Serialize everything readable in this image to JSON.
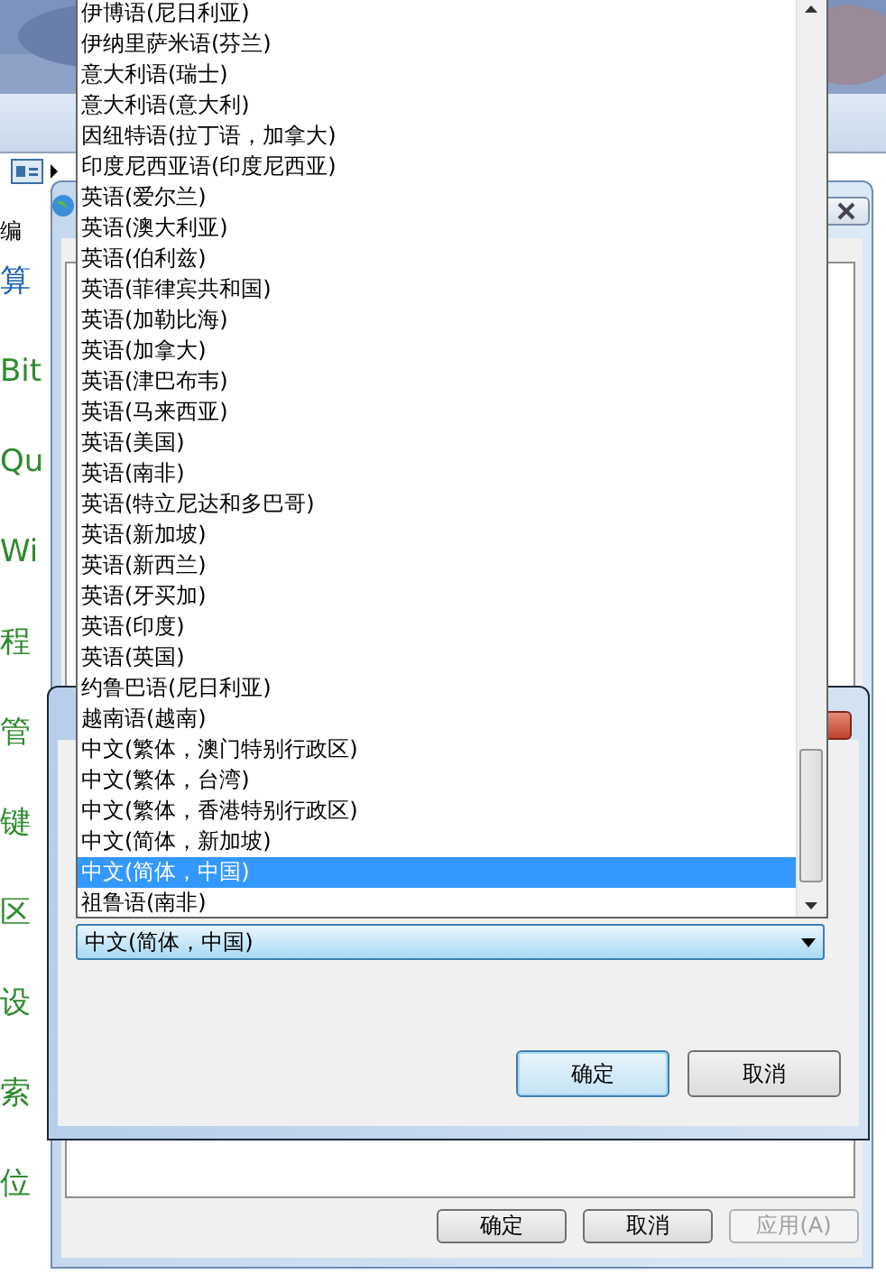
{
  "background": {
    "side_texts": [
      {
        "text": "编",
        "color": "#000000"
      },
      {
        "text": "算",
        "color": "#1a5fb4"
      },
      {
        "text": "Bit",
        "color": "#2e8b2e"
      },
      {
        "text": "Qu",
        "color": "#2e8b2e"
      },
      {
        "text": "Wi",
        "color": "#2e8b2e"
      },
      {
        "text": "程",
        "color": "#2e8b2e"
      },
      {
        "text": "管",
        "color": "#2e8b2e"
      },
      {
        "text": "键",
        "color": "#2e8b2e"
      },
      {
        "text": "区",
        "color": "#2e8b2e"
      },
      {
        "text": "设",
        "color": "#2e8b2e"
      },
      {
        "text": "索",
        "color": "#2e8b2e"
      },
      {
        "text": "位",
        "color": "#2e8b2e"
      }
    ]
  },
  "back_dialog": {
    "buttons": [
      {
        "label": "确定",
        "disabled": false
      },
      {
        "label": "取消",
        "disabled": false
      },
      {
        "label": "应用(A)",
        "disabled": true
      }
    ]
  },
  "front_dialog": {
    "combobox": {
      "value": "中文(简体，中国)"
    },
    "buttons": [
      {
        "label": "确定",
        "default": true
      },
      {
        "label": "取消",
        "default": false
      }
    ]
  },
  "dropdown": {
    "items": [
      {
        "label": "伊博语(尼日利亚)",
        "selected": false
      },
      {
        "label": "伊纳里萨米语(芬兰)",
        "selected": false
      },
      {
        "label": "意大利语(瑞士)",
        "selected": false
      },
      {
        "label": "意大利语(意大利)",
        "selected": false
      },
      {
        "label": "因纽特语(拉丁语，加拿大)",
        "selected": false
      },
      {
        "label": "印度尼西亚语(印度尼西亚)",
        "selected": false
      },
      {
        "label": "英语(爱尔兰)",
        "selected": false
      },
      {
        "label": "英语(澳大利亚)",
        "selected": false
      },
      {
        "label": "英语(伯利兹)",
        "selected": false
      },
      {
        "label": "英语(菲律宾共和国)",
        "selected": false
      },
      {
        "label": "英语(加勒比海)",
        "selected": false
      },
      {
        "label": "英语(加拿大)",
        "selected": false
      },
      {
        "label": "英语(津巴布韦)",
        "selected": false
      },
      {
        "label": "英语(马来西亚)",
        "selected": false
      },
      {
        "label": "英语(美国)",
        "selected": false
      },
      {
        "label": "英语(南非)",
        "selected": false
      },
      {
        "label": "英语(特立尼达和多巴哥)",
        "selected": false
      },
      {
        "label": "英语(新加坡)",
        "selected": false
      },
      {
        "label": "英语(新西兰)",
        "selected": false
      },
      {
        "label": "英语(牙买加)",
        "selected": false
      },
      {
        "label": "英语(印度)",
        "selected": false
      },
      {
        "label": "英语(英国)",
        "selected": false
      },
      {
        "label": "约鲁巴语(尼日利亚)",
        "selected": false
      },
      {
        "label": "越南语(越南)",
        "selected": false
      },
      {
        "label": "中文(繁体，澳门特别行政区)",
        "selected": false
      },
      {
        "label": "中文(繁体，台湾)",
        "selected": false
      },
      {
        "label": "中文(繁体，香港特别行政区)",
        "selected": false
      },
      {
        "label": "中文(简体，新加坡)",
        "selected": false
      },
      {
        "label": "中文(简体，中国)",
        "selected": true
      },
      {
        "label": "祖鲁语(南非)",
        "selected": false
      }
    ]
  }
}
